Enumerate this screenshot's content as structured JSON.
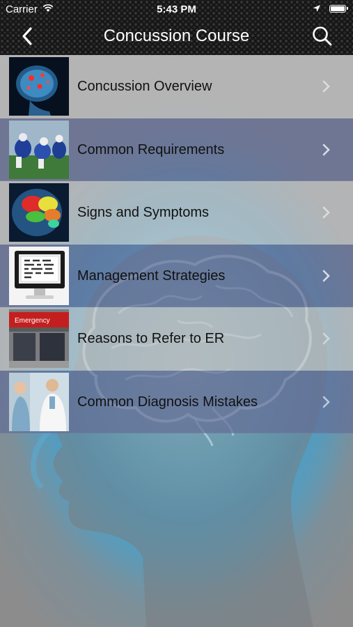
{
  "status_bar": {
    "carrier": "Carrier",
    "time": "5:43 PM"
  },
  "nav": {
    "title": "Concussion Course",
    "back_icon": "chevron-left-icon",
    "search_icon": "search-icon"
  },
  "colors": {
    "row_light": "#c4c4c4",
    "row_dark": "#646e96",
    "nav_bg": "#161616",
    "accent_blue": "#5fb8dc"
  },
  "list": {
    "items": [
      {
        "label": "Concussion Overview",
        "thumb": "glowing brain scan"
      },
      {
        "label": "Common Requirements",
        "thumb": "football players"
      },
      {
        "label": "Signs and Symptoms",
        "thumb": "colored brain"
      },
      {
        "label": "Management Strategies",
        "thumb": "computer monitor"
      },
      {
        "label": "Reasons to Refer to ER",
        "thumb": "emergency entrance"
      },
      {
        "label": "Common Diagnosis Mistakes",
        "thumb": "doctor with patient"
      }
    ]
  }
}
